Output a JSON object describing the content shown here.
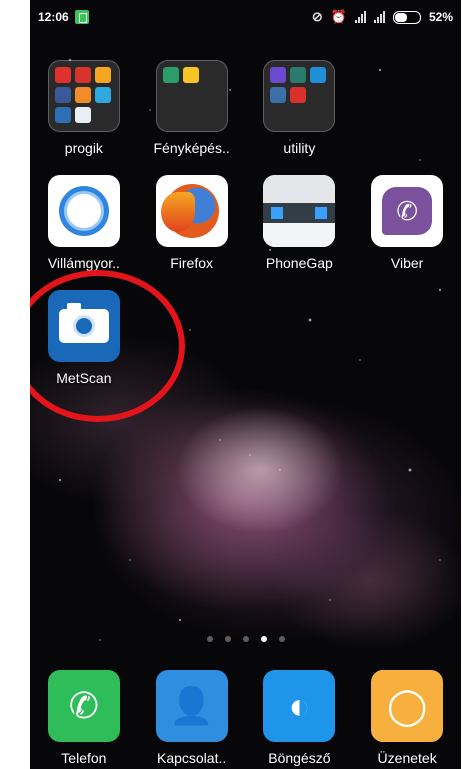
{
  "status_bar": {
    "time": "12:06",
    "battery": "52%",
    "battery_level": 0.52
  },
  "home": {
    "row1": [
      {
        "label": "progik",
        "type": "folder"
      },
      {
        "label": "Fényképés..",
        "type": "folder"
      },
      {
        "label": "utility",
        "type": "folder"
      }
    ],
    "row2": [
      {
        "label": "Villámgyor..",
        "icon": "cleaner-icon"
      },
      {
        "label": "Firefox",
        "icon": "firefox-icon"
      },
      {
        "label": "PhoneGap",
        "icon": "phonegap-icon"
      },
      {
        "label": "Viber",
        "icon": "viber-icon"
      }
    ],
    "row3": [
      {
        "label": "MetScan",
        "icon": "camera-icon",
        "highlighted": true
      }
    ]
  },
  "pager": {
    "pages": 5,
    "current": 4
  },
  "dock": [
    {
      "label": "Telefon",
      "icon": "phone-icon"
    },
    {
      "label": "Kapcsolat..",
      "icon": "contacts-icon"
    },
    {
      "label": "Böngésző",
      "icon": "browser-icon"
    },
    {
      "label": "Üzenetek",
      "icon": "messages-icon"
    }
  ],
  "colors": {
    "highlight_circle": "#e3141a",
    "metscan_bg": "#1a69b8"
  }
}
